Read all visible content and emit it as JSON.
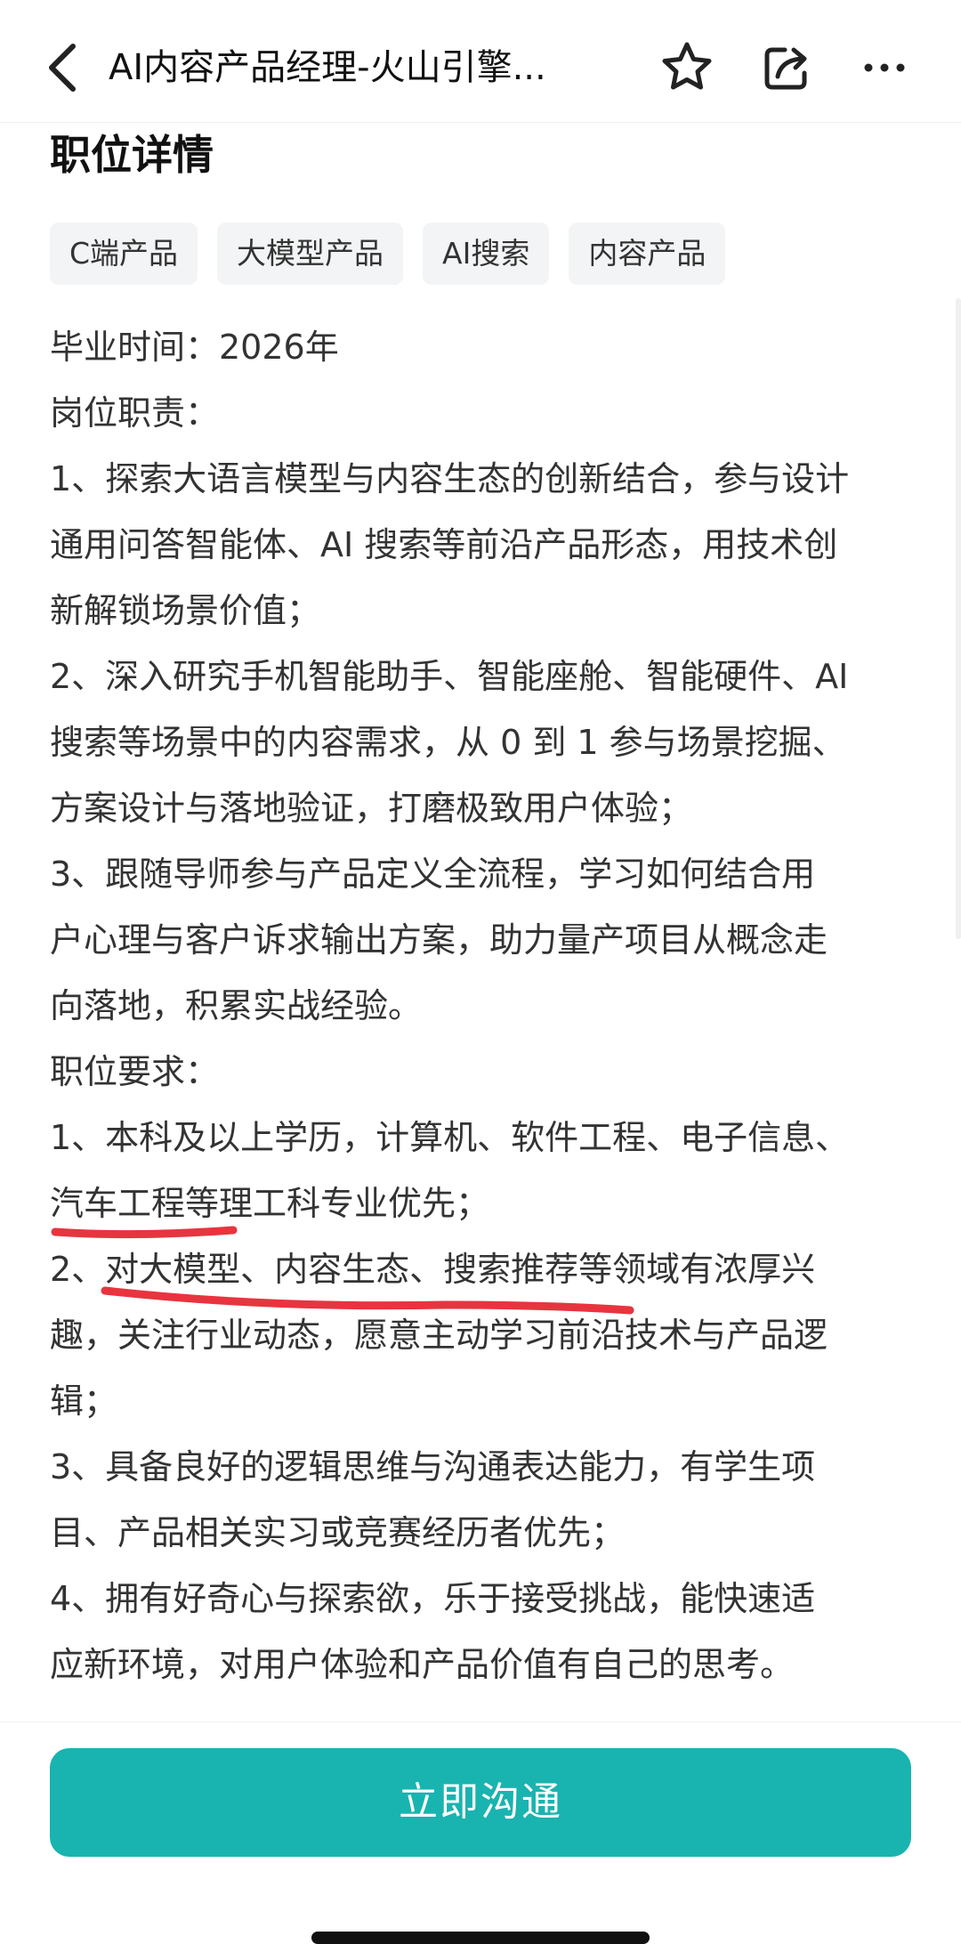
{
  "header": {
    "title": "AI内容产品经理-火山引擎...",
    "back_icon": "chevron-left-icon",
    "star_icon": "star-outline-icon",
    "share_icon": "share-icon",
    "more_icon": "more-horizontal-icon"
  },
  "section": {
    "title": "职位详情"
  },
  "tags": [
    "C端产品",
    "大模型产品",
    "AI搜索",
    "内容产品"
  ],
  "description_lines": [
    "毕业时间：2026年",
    "岗位职责：",
    "1、探索大语言模型与内容生态的创新结合，参与设计",
    "通用问答智能体、AI 搜索等前沿产品形态，用技术创",
    "新解锁场景价值；",
    "2、深入研究手机智能助手、智能座舱、智能硬件、AI",
    "搜索等场景中的内容需求，从 0 到 1 参与场景挖掘、",
    "方案设计与落地验证，打磨极致用户体验；",
    "3、跟随导师参与产品定义全流程，学习如何结合用",
    "户心理与客户诉求输出方案，助力量产项目从概念走",
    "向落地，积累实战经验。",
    "职位要求：",
    "1、本科及以上学历，计算机、软件工程、电子信息、",
    "汽车工程等理工科专业优先；",
    "2、对大模型、内容生态、搜索推荐等领域有浓厚兴",
    "趣，关注行业动态，愿意主动学习前沿技术与产品逻",
    "辑；",
    "3、具备良好的逻辑思维与沟通表达能力，有学生项",
    "目、产品相关实习或竞赛经历者优先；",
    "4、拥有好奇心与探索欲，乐于接受挑战，能快速适",
    "应新环境，对用户体验和产品价值有自己的思考。"
  ],
  "cta": {
    "label": "立即沟通"
  },
  "colors": {
    "accent": "#19b3b0",
    "annotation": "#e8343f",
    "tag_bg": "#f3f4f6"
  }
}
